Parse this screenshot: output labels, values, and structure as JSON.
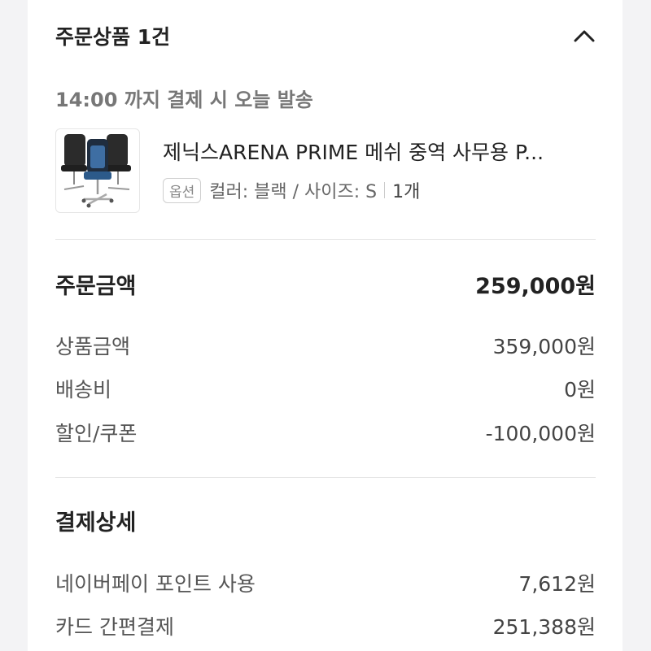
{
  "order_items": {
    "title": "주문상품 1건",
    "collapse_icon": "chevron-up-icon",
    "shipping_notice": "14:00 까지 결제 시 오늘 발송",
    "product": {
      "name": "제닉스ARENA PRIME 메쉬 중역 사무용 P...",
      "option_badge": "옵션",
      "option_text": "컬러: 블랙 / 사이즈: S",
      "quantity": "1개"
    }
  },
  "order_amount": {
    "label": "주문금액",
    "total": "259,000원",
    "rows": [
      {
        "label": "상품금액",
        "value": "359,000원"
      },
      {
        "label": "배송비",
        "value": "0원"
      },
      {
        "label": "할인/쿠폰",
        "value": "-100,000원"
      }
    ]
  },
  "payment_details": {
    "label": "결제상세",
    "rows": [
      {
        "label": "네이버페이 포인트 사용",
        "value": "7,612원"
      },
      {
        "label": "카드 간편결제",
        "value": "251,388원"
      }
    ]
  }
}
